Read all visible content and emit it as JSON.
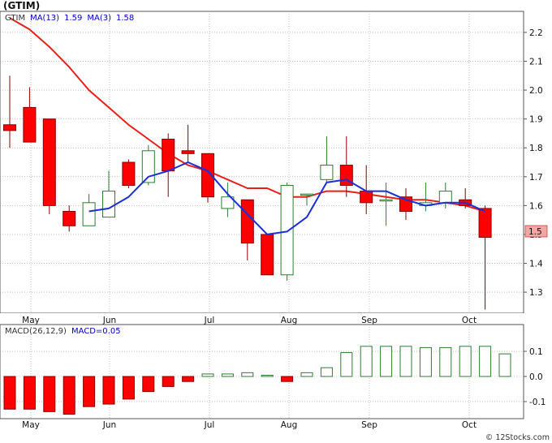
{
  "header": {
    "ticker_title": "(GTIM)",
    "main_legend": [
      {
        "text": "GTIM",
        "color": "#333333"
      },
      {
        "text": "MA(13)",
        "color": "#0000cc"
      },
      {
        "text": "1.59",
        "color": "#0000cc"
      },
      {
        "text": "MA(3)",
        "color": "#0000cc"
      },
      {
        "text": "1.58",
        "color": "#0000cc"
      }
    ],
    "macd_legend": [
      {
        "text": "MACD(26,12,9)",
        "color": "#333333"
      },
      {
        "text": "MACD=0.05",
        "color": "#0000cc"
      }
    ],
    "current_price_label": "1.5"
  },
  "footer": {
    "watermark": "© 12Stocks.com"
  },
  "colors": {
    "up": "#ffffff",
    "up_stroke": "#2e7d32",
    "down": "#ff0000",
    "down_stroke": "#8b0000",
    "ma13": "#e8201a",
    "ma3": "#1a2fd6",
    "macd_pos": "#ffffff",
    "macd_pos_stroke": "#2e7d32",
    "macd_neg": "#ff0000",
    "macd_neg_stroke": "#8b0000",
    "grid": "#999999",
    "price_box": "#f4a6a6"
  },
  "chart_data": [
    {
      "type": "candlestick",
      "title": "(GTIM)",
      "x_tick_labels": [
        "May",
        "Jun",
        "Jul",
        "Aug",
        "Sep",
        "Oct"
      ],
      "y_tick_labels": [
        "1.3",
        "1.4",
        "1.5",
        "1.6",
        "1.7",
        "1.8",
        "1.9",
        "2.0",
        "2.1",
        "2.2"
      ],
      "ylim": [
        1.23,
        2.27
      ],
      "grid": true,
      "candles": [
        {
          "open": 1.88,
          "high": 2.05,
          "low": 1.8,
          "close": 1.86
        },
        {
          "open": 1.94,
          "high": 2.01,
          "low": 1.82,
          "close": 1.82
        },
        {
          "open": 1.9,
          "high": 1.9,
          "low": 1.57,
          "close": 1.6
        },
        {
          "open": 1.58,
          "high": 1.6,
          "low": 1.51,
          "close": 1.53
        },
        {
          "open": 1.53,
          "high": 1.64,
          "low": 1.53,
          "close": 1.61
        },
        {
          "open": 1.56,
          "high": 1.72,
          "low": 1.56,
          "close": 1.65
        },
        {
          "open": 1.75,
          "high": 1.76,
          "low": 1.66,
          "close": 1.67
        },
        {
          "open": 1.68,
          "high": 1.81,
          "low": 1.67,
          "close": 1.79
        },
        {
          "open": 1.83,
          "high": 1.85,
          "low": 1.63,
          "close": 1.72
        },
        {
          "open": 1.79,
          "high": 1.88,
          "low": 1.75,
          "close": 1.78
        },
        {
          "open": 1.78,
          "high": 1.78,
          "low": 1.61,
          "close": 1.63
        },
        {
          "open": 1.59,
          "high": 1.68,
          "low": 1.56,
          "close": 1.63
        },
        {
          "open": 1.62,
          "high": 1.62,
          "low": 1.41,
          "close": 1.47
        },
        {
          "open": 1.5,
          "high": 1.5,
          "low": 1.36,
          "close": 1.36
        },
        {
          "open": 1.36,
          "high": 1.68,
          "low": 1.34,
          "close": 1.67
        },
        {
          "open": 1.64,
          "high": 1.64,
          "low": 1.6,
          "close": 1.64
        },
        {
          "open": 1.69,
          "high": 1.84,
          "low": 1.68,
          "close": 1.74
        },
        {
          "open": 1.74,
          "high": 1.84,
          "low": 1.63,
          "close": 1.67
        },
        {
          "open": 1.65,
          "high": 1.74,
          "low": 1.57,
          "close": 1.61
        },
        {
          "open": 1.62,
          "high": 1.68,
          "low": 1.53,
          "close": 1.62
        },
        {
          "open": 1.63,
          "high": 1.66,
          "low": 1.55,
          "close": 1.58
        },
        {
          "open": 1.6,
          "high": 1.68,
          "low": 1.58,
          "close": 1.61
        },
        {
          "open": 1.61,
          "high": 1.68,
          "low": 1.59,
          "close": 1.65
        },
        {
          "open": 1.62,
          "high": 1.66,
          "low": 1.59,
          "close": 1.6
        },
        {
          "open": 1.59,
          "high": 1.6,
          "low": 1.24,
          "close": 1.49
        }
      ],
      "series": [
        {
          "name": "MA(13)",
          "values": [
            2.25,
            2.21,
            2.15,
            2.08,
            2.0,
            1.94,
            1.88,
            1.83,
            1.78,
            1.74,
            1.72,
            1.69,
            1.66,
            1.66,
            1.63,
            1.63,
            1.65,
            1.65,
            1.64,
            1.63,
            1.62,
            1.62,
            1.61,
            1.6,
            1.58
          ]
        },
        {
          "name": "MA(3)",
          "values": [
            null,
            null,
            null,
            null,
            1.58,
            1.59,
            1.63,
            1.7,
            1.72,
            1.75,
            1.72,
            1.64,
            1.57,
            1.5,
            1.51,
            1.56,
            1.68,
            1.69,
            1.65,
            1.65,
            1.62,
            1.6,
            1.61,
            1.61,
            1.58
          ]
        }
      ],
      "current_price": 1.5
    },
    {
      "type": "bar",
      "title": "MACD(26,12,9)",
      "x_tick_labels": [
        "May",
        "Jun",
        "Jul",
        "Aug",
        "Sep",
        "Oct"
      ],
      "y_tick_labels": [
        "0.1",
        "0.0",
        "-0.1"
      ],
      "ylim": [
        -0.155,
        0.155
      ],
      "values": [
        -0.13,
        -0.13,
        -0.14,
        -0.15,
        -0.12,
        -0.11,
        -0.09,
        -0.06,
        -0.04,
        -0.02,
        0.01,
        0.01,
        0.015,
        0.005,
        -0.02,
        0.015,
        0.035,
        0.095,
        0.12,
        0.12,
        0.12,
        0.115,
        0.115,
        0.12,
        0.12,
        0.09
      ]
    }
  ]
}
